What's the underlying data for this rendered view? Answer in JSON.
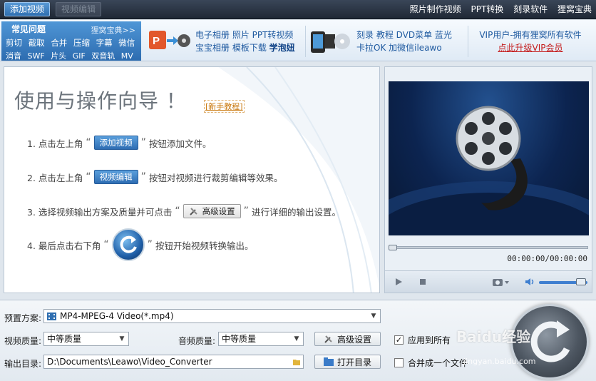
{
  "toolbar": {
    "add_video": "添加视频",
    "edit_video": "视频编辑",
    "links": [
      "照片制作视频",
      "PPT转换",
      "刻录软件",
      "狸窝宝典"
    ]
  },
  "faq": {
    "title": "常见问题",
    "more": "狸窝宝典>>",
    "row1": [
      "剪切",
      "截取",
      "合并",
      "压缩",
      "字幕",
      "微信"
    ],
    "row2": [
      "消音",
      "SWF",
      "片头",
      "GIF",
      "双音轨",
      "MV"
    ]
  },
  "promo1": {
    "line1": "电子相册  照片 PPT转视频",
    "line2_a": "宝宝相册  模板下载 ",
    "line2_b": "学泡妞"
  },
  "promo2": {
    "line1": "刻录 教程 DVD菜单 蓝光",
    "line2": "卡拉OK 加微信ileawo"
  },
  "vip": {
    "line1": "VIP用户-拥有狸窝所有软件",
    "link": "点此升级VIP会员"
  },
  "guide": {
    "title": "使用与操作向导 ！",
    "tutorial_link": "[新手教程]",
    "step1_pre": "1. 点击左上角",
    "step1_chip": "添加视频",
    "step1_post": "按钮添加文件。",
    "step2_pre": "2. 点击左上角",
    "step2_chip": "视频编辑",
    "step2_post": "按钮对视频进行裁剪编辑等效果。",
    "step3_pre": "3. 选择视频输出方案及质量并可点击",
    "step3_chip": "高级设置",
    "step3_post": "进行详细的输出设置。",
    "step4_pre": "4. 最后点击右下角",
    "step4_post": "按钮开始视频转换输出。",
    "quote_open": "“",
    "quote_close": "”"
  },
  "player": {
    "timecode": "00:00:00/00:00:00",
    "progress": 0,
    "volume": 0.85
  },
  "settings": {
    "preset_label": "预置方案:",
    "preset_value": "MP4-MPEG-4 Video(*.mp4)",
    "video_quality_label": "视频质量:",
    "video_quality_value": "中等质量",
    "audio_quality_label": "音频质量:",
    "audio_quality_value": "中等质量",
    "advanced_button": "高级设置",
    "apply_all_label": "应用到所有",
    "apply_all_checked": true,
    "output_label": "输出目录:",
    "output_path": "D:\\Documents\\Leawo\\Video_Converter",
    "open_dir_button": "打开目录",
    "merge_label": "合并成一个文件",
    "merge_checked": false
  },
  "watermark": {
    "main": "Baidu经验",
    "sub": "jingyan.baidu.com"
  },
  "colors": {
    "accent_blue": "#2f6fb1",
    "vip_red": "#c41a1a",
    "link_orange": "#c8760a"
  }
}
